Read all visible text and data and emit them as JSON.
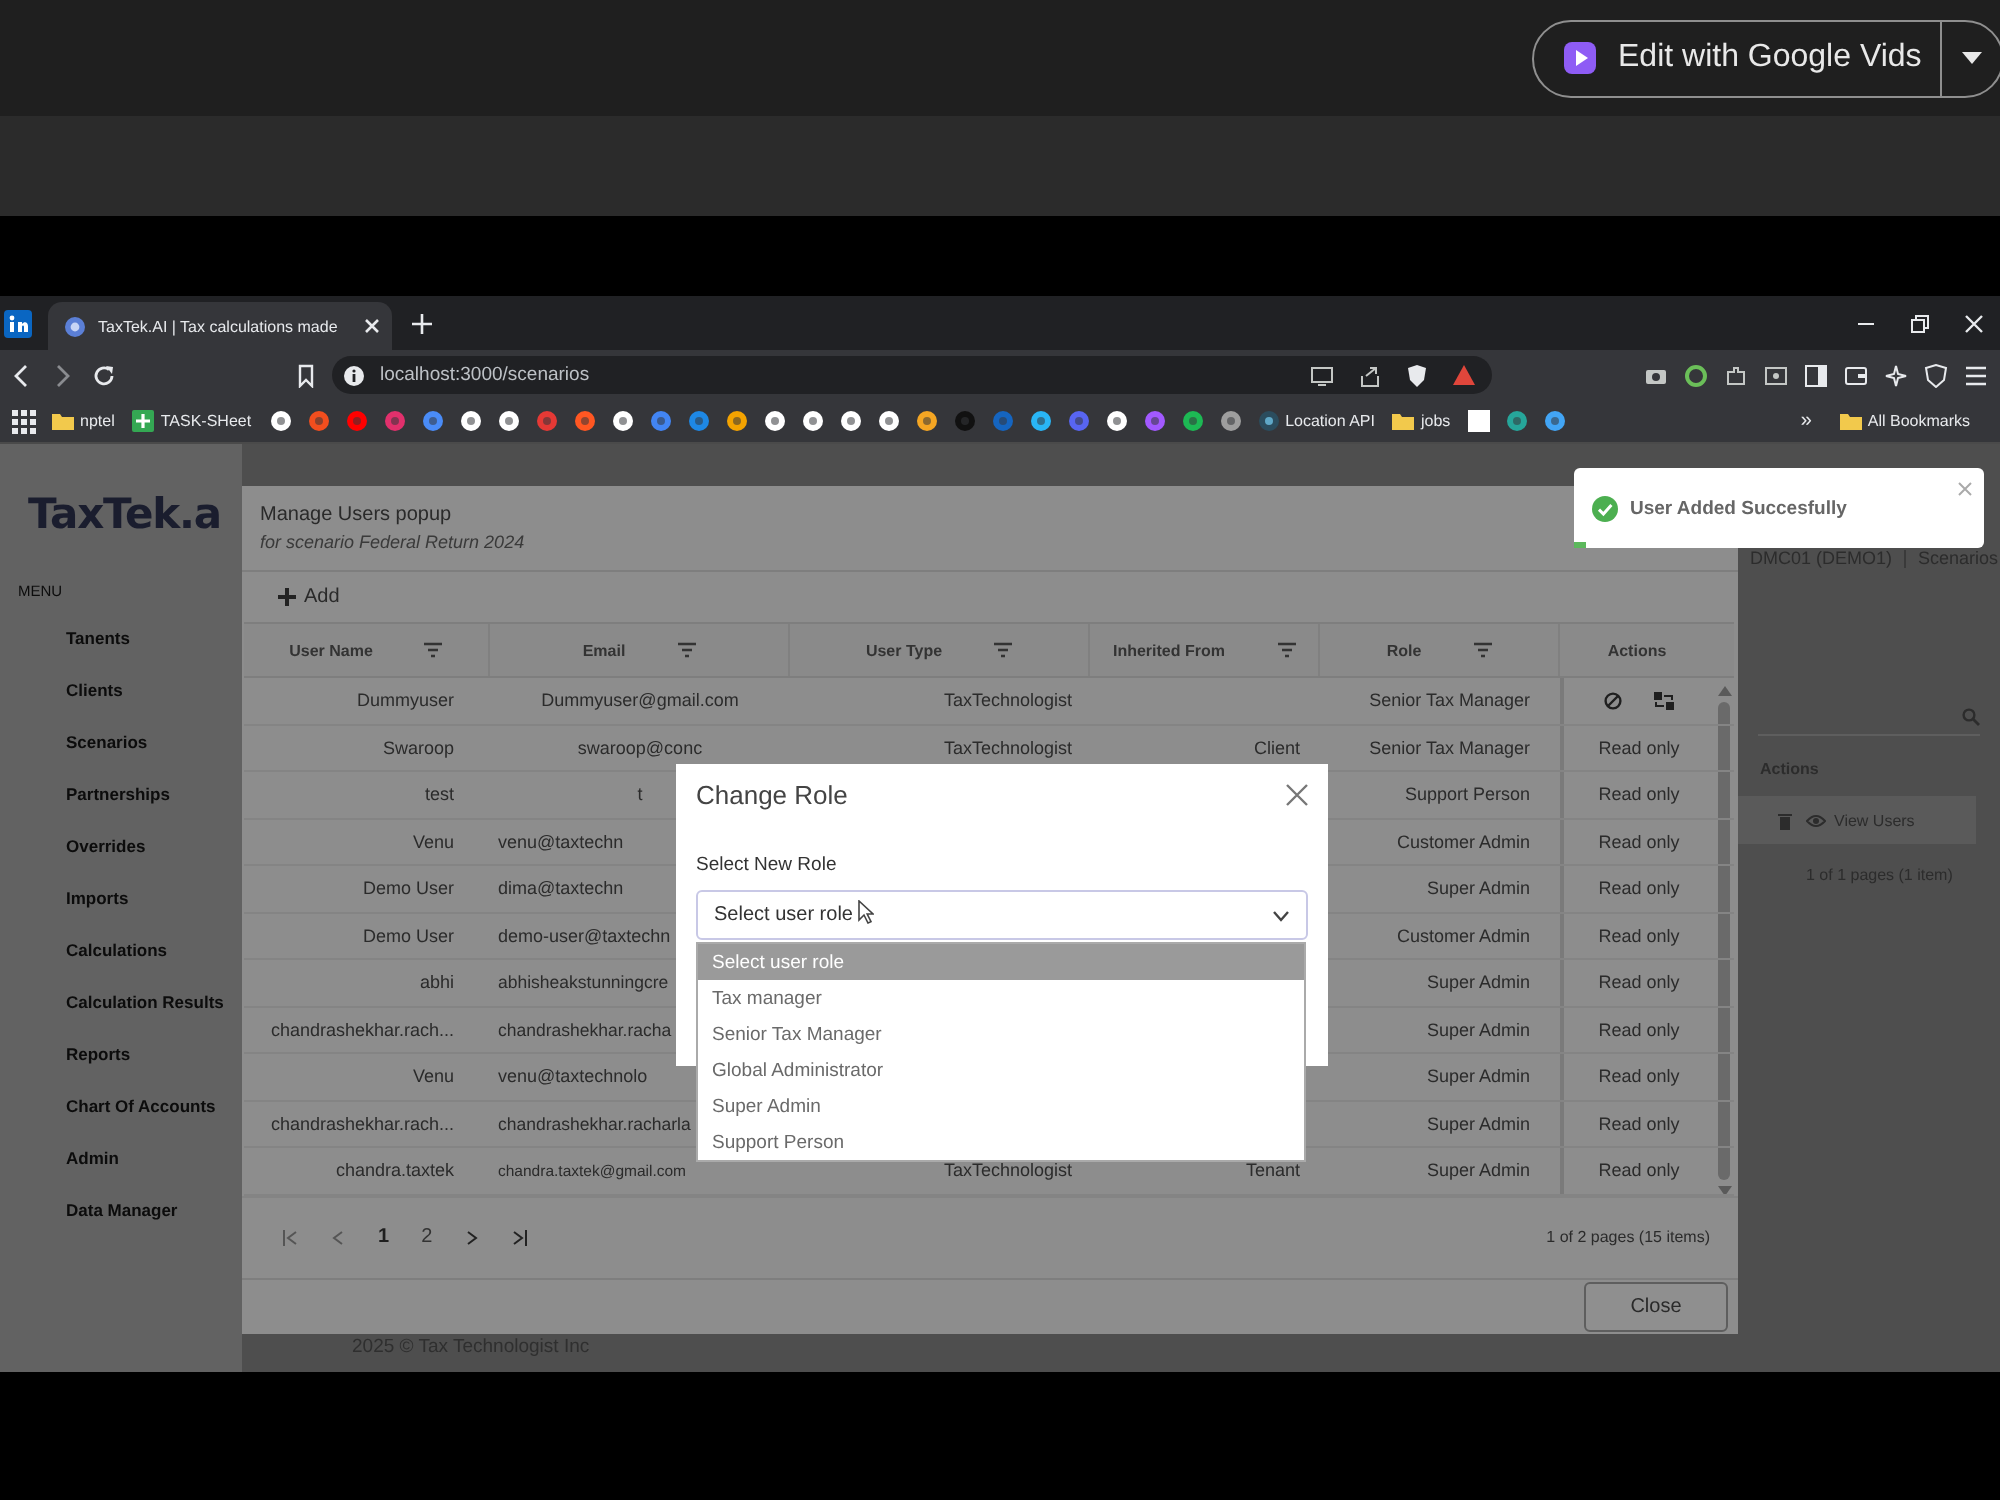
{
  "player_bar": {
    "edit_button": {
      "label": "Edit with Google Vids"
    }
  },
  "browser": {
    "tabs": [
      {
        "title": "TaxTek.AI | Tax calculations made",
        "selected": true
      }
    ],
    "url": "localhost:3000/scenarios",
    "bookmarks": [
      {
        "kind": "folder",
        "label": "nptel"
      },
      {
        "kind": "sheet",
        "label": "TASK-SHeet"
      },
      {
        "kind": "site",
        "label": "Location API"
      },
      {
        "kind": "folder",
        "label": "jobs"
      }
    ],
    "more": "»",
    "all_bookmarks": "All Bookmarks"
  },
  "app": {
    "logo": "TaxTek.a",
    "menu_heading": "MENU",
    "menu": [
      "Tanents",
      "Clients",
      "Scenarios",
      "Partnerships",
      "Overrides",
      "Imports",
      "Calculations",
      "Calculation Results",
      "Reports",
      "Chart Of Accounts",
      "Admin",
      "Data Manager"
    ],
    "breadcrumb": [
      "DMC01 (DEMO1)",
      "Scenarios"
    ],
    "table": {
      "column": "Actions",
      "row_action": "View Users",
      "pager": "1 of 1 pages (1 item)"
    },
    "footer": "2025 © Tax Technologist Inc"
  },
  "popup": {
    "title": "Manage Users popup",
    "subtitle": "for scenario Federal Return 2024",
    "add": "Add",
    "columns": [
      {
        "label": "User Name",
        "filter": true
      },
      {
        "label": "Email",
        "filter": true
      },
      {
        "label": "User Type",
        "filter": true
      },
      {
        "label": "Inherited From",
        "filter": true
      },
      {
        "label": "Role",
        "filter": true
      },
      {
        "label": "Actions",
        "filter": false
      }
    ],
    "rows": [
      {
        "user_name": "Dummyuser",
        "email": "Dummyuser@gmail.com",
        "user_type": "TaxTechnologist",
        "role": "Senior Tax Manager",
        "kind": "icons"
      },
      {
        "user_name": "Swaroop",
        "email": "swaroop@conc",
        "user_type": "TaxTechnologist",
        "inherited_from": "Client",
        "role": "Senior Tax Manager",
        "kind": "text",
        "actions": "Read only"
      },
      {
        "user_name": "test",
        "email": "t",
        "role": "Support Person",
        "kind": "text",
        "actions": "Read only"
      },
      {
        "user_name": "Venu",
        "email": "venu@taxtechn",
        "role": "Customer Admin",
        "kind": "text",
        "actions": "Read only"
      },
      {
        "user_name": "Demo User",
        "email": "dima@taxtechn",
        "role": "Super Admin",
        "kind": "text",
        "actions": "Read only"
      },
      {
        "user_name": "Demo User",
        "email": "demo-user@taxtechn",
        "role": "Customer Admin",
        "kind": "text",
        "actions": "Read only"
      },
      {
        "user_name": "abhi",
        "email": "abhisheakstunningcre",
        "role": "Super Admin",
        "kind": "text",
        "actions": "Read only"
      },
      {
        "user_name": "chandrashekhar.rach...",
        "email": "chandrashekhar.racha",
        "role": "Super Admin",
        "kind": "text",
        "actions": "Read only"
      },
      {
        "user_name": "Venu",
        "email": "venu@taxtechnolo",
        "role": "Super Admin",
        "kind": "text",
        "actions": "Read only"
      },
      {
        "user_name": "chandrashekhar.rach...",
        "email": "chandrashekhar.racharla",
        "role": "Super Admin",
        "kind": "text",
        "actions": "Read only"
      },
      {
        "user_name": "chandra.taxtek",
        "email": "chandra.taxtek@gmail.com",
        "user_type": "TaxTechnologist",
        "inherited_from": "Tenant",
        "role": "Super Admin",
        "kind": "text",
        "actions": "Read only"
      }
    ],
    "pages": [
      {
        "label": "1",
        "selected": true
      },
      {
        "label": "2",
        "selected": false
      }
    ],
    "summary": "1 of 2 pages (15 items)",
    "close": "Close"
  },
  "dialog": {
    "title": "Change Role",
    "label": "Select New Role",
    "value": "Select user role",
    "options": [
      {
        "label": "Select user role",
        "selected": true
      },
      {
        "label": "Tax manager",
        "selected": false
      },
      {
        "label": "Senior Tax Manager",
        "selected": false
      },
      {
        "label": "Global Administrator",
        "selected": false
      },
      {
        "label": "Super Admin",
        "selected": false
      },
      {
        "label": "Support Person",
        "selected": false
      }
    ]
  },
  "toast": {
    "message": "User Added Succesfully",
    "level": 0.03
  }
}
